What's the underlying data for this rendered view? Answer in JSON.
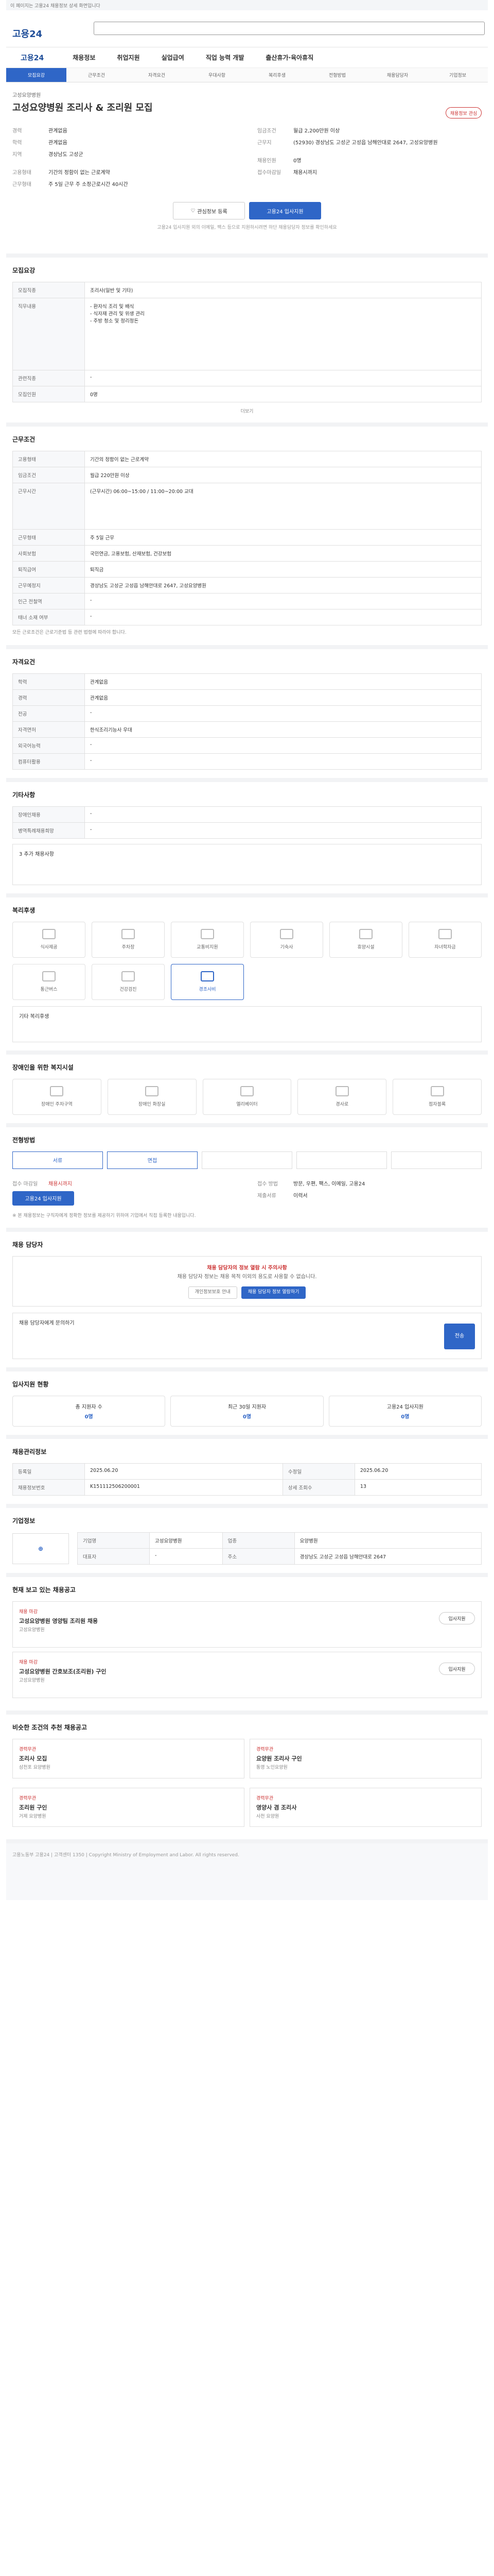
{
  "topbar": {
    "notice": "이 페이지는 고용24 채용정보 상세 화면입니다"
  },
  "header": {
    "logo": "고용24",
    "search_placeholder": ""
  },
  "gnb": [
    "채용정보",
    "취업지원",
    "실업급여",
    "직업 능력 개발",
    "출산휴가·육아휴직"
  ],
  "tabs": [
    "모집요강",
    "근무조건",
    "자격요건",
    "우대사항",
    "복리후생",
    "전형방법",
    "채용담당자",
    "기업정보"
  ],
  "job": {
    "company": "고성요양병원",
    "title": "고성요양병원 조리사 & 조리원 모집",
    "bookmark": "채용정보 관심",
    "left": [
      {
        "k": "경력",
        "v": "관계없음"
      },
      {
        "k": "학력",
        "v": "관계없음"
      },
      {
        "k": "지역",
        "v": "경상남도 고성군"
      },
      {
        "k": "고용형태",
        "v": "기간의 정함이 없는 근로계약"
      },
      {
        "k": "근무형태",
        "v": "주 5일 근무 주 소정근로시간 40시간"
      }
    ],
    "right": [
      {
        "k": "임금조건",
        "v": "월급 2,200만원 이상"
      },
      {
        "k": "근무지",
        "v": "(52930) 경상남도 고성군 고성읍 남해안대로 2647, 고성요양병원"
      },
      {
        "k": "채용인원",
        "v": "0명"
      },
      {
        "k": "접수마감일",
        "v": "채용시까지"
      }
    ],
    "btn_interest": "관심정보 등록",
    "btn_apply": "고용24 입사지원",
    "apply_note": "고용24 입사지원 외의 이메일, 팩스 등으로 지원하시려면 하단 채용담당자 정보를 확인하세요"
  },
  "recruit": {
    "title": "모집요강",
    "rows": [
      {
        "k": "모집직종",
        "v": "조리사(일반 및 기타)"
      },
      {
        "k": "직무내용",
        "v": "- 환자식 조리 및 배식\n- 식자재 관리 및 위생 관리\n- 주방 청소 및 정리정돈"
      },
      {
        "k": "관련직종",
        "v": "-"
      },
      {
        "k": "모집인원",
        "v": "0명"
      }
    ],
    "more": "더보기"
  },
  "work": {
    "title": "근무조건",
    "rows": [
      {
        "k": "고용형태",
        "v": "기간의 정함이 없는 근로계약"
      },
      {
        "k": "임금조건",
        "v": "월급 220만원 이상"
      },
      {
        "k": "근무시간",
        "v": "(근무시간) 06:00~15:00 / 11:00~20:00 교대"
      },
      {
        "k": "근무형태",
        "v": "주 5일 근무"
      },
      {
        "k": "사회보험",
        "v": "국민연금, 고용보험, 산재보험, 건강보험"
      },
      {
        "k": "퇴직급여",
        "v": "퇴직금"
      },
      {
        "k": "근무예정지",
        "v": "경상남도 고성군 고성읍 남해안대로 2647, 고성요양병원"
      },
      {
        "k": "인근 전철역",
        "v": "-"
      },
      {
        "k": "태너 소재 여부",
        "v": "-"
      }
    ],
    "note": "모든 근로조건은 근로기준법 등 관련 법령에 따라야 합니다."
  },
  "qual": {
    "title": "자격요건",
    "rows": [
      {
        "k": "학력",
        "v": "관계없음"
      },
      {
        "k": "경력",
        "v": "관계없음"
      },
      {
        "k": "전공",
        "v": "-"
      },
      {
        "k": "자격면허",
        "v": "한식조리기능사 우대"
      },
      {
        "k": "외국어능력",
        "v": "-"
      },
      {
        "k": "컴퓨터활용",
        "v": "-"
      }
    ]
  },
  "pref": {
    "title": "기타사항",
    "rows": [
      {
        "k": "장애인채용",
        "v": "-"
      },
      {
        "k": "병역특례채용희망",
        "v": "-"
      }
    ],
    "text": "3 추가 채용사항"
  },
  "welfare": {
    "title": "복리후생",
    "icons": [
      "식사제공",
      "주차장",
      "교통비지원",
      "기숙사",
      "휴양시설",
      "자녀학자금",
      "통근버스",
      "건강검진",
      "경조사비"
    ],
    "active": 8,
    "etc_label": "기타 복리후생"
  },
  "disabled": {
    "title": "장애인을 위한 복지시설",
    "icons": [
      "장애인 주차구역",
      "장애인 화장실",
      "엘리베이터",
      "경사로",
      "점자블록"
    ]
  },
  "process": {
    "title": "전형방법",
    "steps": [
      "서류",
      "면접",
      "",
      "",
      ""
    ],
    "submit_title": "접수 마감일",
    "submit_value": "채용시까지",
    "method_title": "접수 방법",
    "method_value": "방문, 우편, 팩스, 이메일, 고용24",
    "apply_btn": "고용24 입사지원",
    "docs_title": "제출서류",
    "docs_value": "이력서",
    "caution": "※ 본 채용정보는 구직자에게 정확한 정보를 제공하기 위하여 기업에서 직접 등록한 내용입니다."
  },
  "contact": {
    "title": "채용 담당자",
    "warn1": "채용 담당자의 정보 열람 시 주의사항",
    "warn2": "채용 담당자 정보는 채용 목적 이외의 용도로 사용할 수 없습니다.",
    "btn1": "개인정보보호 안내",
    "btn2": "채용 담당자 정보 열람하기",
    "qa_title": "채용 담당자에게 문의하기",
    "qa_btn": "전송"
  },
  "stats": {
    "title": "입사지원 현황",
    "items": [
      {
        "label": "총 지원자 수",
        "value": "0명"
      },
      {
        "label": "최근 30일 지원자",
        "value": "0명"
      },
      {
        "label": "고용24 입사지원",
        "value": "0명"
      }
    ]
  },
  "manage": {
    "title": "채용관리정보",
    "rows": [
      {
        "k": "등록일",
        "v": "2025.06.20"
      },
      {
        "k": "채용정보번호",
        "v": "K151112506200001"
      },
      {
        "k": "수정일",
        "v": "2025.06.20"
      },
      {
        "k": "상세 조회수",
        "v": "13"
      }
    ]
  },
  "company": {
    "title": "기업정보",
    "name": "고성요양병원",
    "rows": [
      {
        "k": "기업명",
        "v": "고성요양병원"
      },
      {
        "k": "업종",
        "v": "요양병원"
      },
      {
        "k": "대표자",
        "v": "-"
      },
      {
        "k": "주소",
        "v": "경상남도 고성군 고성읍 남해안대로 2647"
      }
    ]
  },
  "similar": {
    "title": "현재 보고 있는 채용공고",
    "cards": [
      {
        "tag": "채용 마감",
        "title": "고성요양병원 영양팀 조리원 채용",
        "company": "고성요양병원",
        "apply": "입사지원"
      },
      {
        "tag": "채용 마감",
        "title": "고성요양병원 간호보조(조리원) 구인",
        "company": "고성요양병원",
        "apply": "입사지원"
      }
    ]
  },
  "recommend": {
    "title": "비슷한 조건의 추천 채용공고",
    "cards": [
      {
        "tag": "경력무관",
        "title": "조리사 모집",
        "company": "삼천포 요양병원"
      },
      {
        "tag": "경력무관",
        "title": "요양원 조리사 구인",
        "company": "통영 노인요양원"
      },
      {
        "tag": "경력무관",
        "title": "조리원 구인",
        "company": "거제 요양병원"
      },
      {
        "tag": "경력무관",
        "title": "영양사 겸 조리사",
        "company": "사천 요양원"
      }
    ]
  },
  "footer": {
    "text": "고용노동부 고용24 | 고객센터 1350 | Copyright Ministry of Employment and Labor. All rights reserved."
  }
}
